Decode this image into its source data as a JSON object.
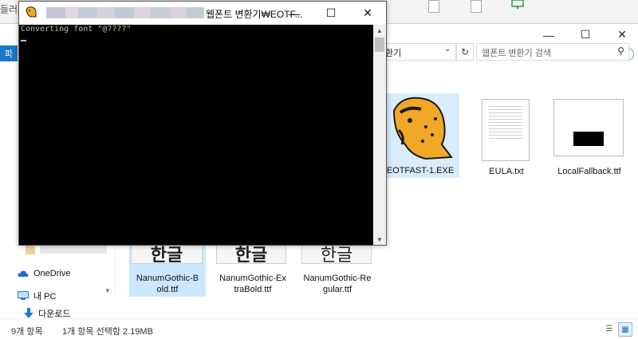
{
  "desktop": {
    "fragment_text": "들러그"
  },
  "explorer": {
    "file_tab": "파",
    "address": "환기",
    "search_placeholder": "웹폰트 변환기 검색",
    "nav_items": [
      {
        "label": "OneDrive",
        "icon": "cloud-icon"
      },
      {
        "label": "내 PC",
        "icon": "pc-icon"
      },
      {
        "label": "다운로드",
        "icon": "download-icon"
      }
    ],
    "files": [
      {
        "name": "EOTFAST-1.EXE",
        "icon": "cheetah-app-icon",
        "selected": false
      },
      {
        "name": "EULA.txt",
        "icon": "text-document-icon",
        "selected": false
      },
      {
        "name": "LocalFallback.ttf",
        "icon": "font-file-icon",
        "selected": false
      },
      {
        "name": "NanumGothic-Bold.ttf",
        "line1": "NanumGothic-B",
        "line2": "old.ttf",
        "glyph": "한글",
        "selected": true
      },
      {
        "name": "NanumGothic-ExtraBold.ttf",
        "line1": "NanumGothic-Ex",
        "line2": "traBold.ttf",
        "glyph": "한글",
        "selected": false
      },
      {
        "name": "NanumGothic-Regular.ttf",
        "line1": "NanumGothic-Re",
        "line2": "gular.ttf",
        "glyph": "한글",
        "selected": false
      }
    ],
    "status": {
      "count": "9개 항목",
      "selection": "1개 항목 선택함 2.19MB"
    }
  },
  "console": {
    "title": "웹폰트 변환기₩EOTF...",
    "output": "Converting font \"@????\"",
    "colors": {
      "background": "#000000",
      "text": "#c0c0c0"
    }
  }
}
